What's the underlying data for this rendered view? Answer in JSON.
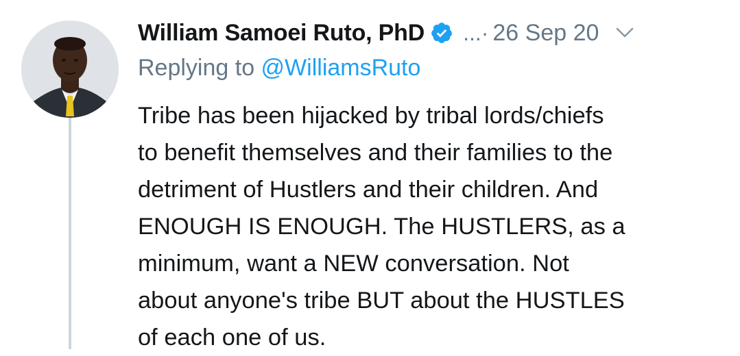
{
  "tweet": {
    "author": {
      "display_name": "William Samoei Ruto, PhD",
      "verified_icon": "verified-badge-icon",
      "avatar_icon": "avatar"
    },
    "more_indicator": "...·",
    "date": "26 Sep 20",
    "reply": {
      "prefix": "Replying to ",
      "handle": "@WilliamsRuto"
    },
    "text_lines": [
      "Tribe has been hijacked by tribal lords/chiefs",
      "to benefit themselves and their families to the",
      "detriment of Hustlers and their children. And",
      "ENOUGH IS ENOUGH. The HUSTLERS, as a",
      "minimum, want a NEW conversation. Not",
      "about anyone's tribe BUT about the HUSTLES",
      "of each one of us."
    ]
  },
  "colors": {
    "text": "#14171a",
    "muted": "#657786",
    "accent": "#1da1f2",
    "thread_line": "#ccd6dd"
  }
}
